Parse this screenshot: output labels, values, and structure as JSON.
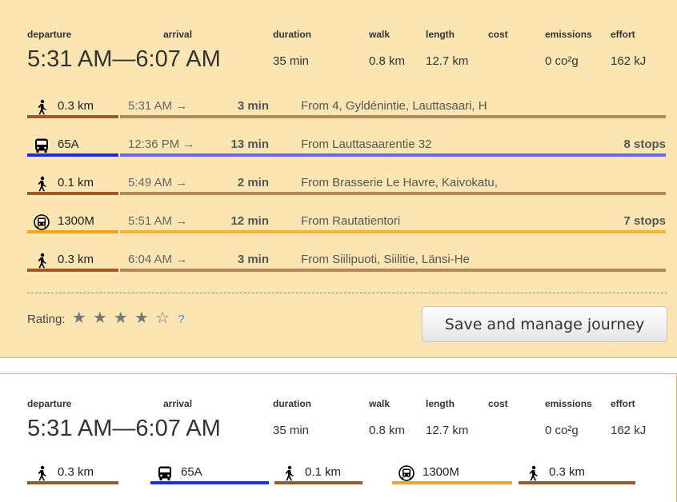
{
  "colors": {
    "card_bg": "#fbe6b3",
    "walk": "#9b5a24",
    "bus": "#1a2fd6",
    "metro": "#f3a51c",
    "rating_help": "#3a8fd8"
  },
  "journey1": {
    "labels": {
      "departure": "departure",
      "arrival": "arrival",
      "duration": "duration",
      "walk": "walk",
      "length": "length",
      "cost": "cost",
      "emissions": "emissions",
      "effort": "effort"
    },
    "departure_time": "5:31 AM",
    "dash": "—",
    "arrival_time": "6:07 AM",
    "duration": "35 min",
    "walk": "0.8 km",
    "length": "12.7 km",
    "emissions": "0 co²g",
    "effort": "162 kJ",
    "legs": [
      {
        "mode": "walk",
        "icon": "walk-icon",
        "label": "0.3 km",
        "start": "5:31 AM →",
        "duration": "3 min",
        "from": "From 4, Gyldénintie, Lauttasaari, H",
        "stops": ""
      },
      {
        "mode": "bus",
        "icon": "bus-icon",
        "label": "65A",
        "start": "12:36 PM →",
        "duration": "13 min",
        "from": "From Lauttasaarentie 32",
        "stops": "8 stops"
      },
      {
        "mode": "walk",
        "icon": "walk-icon",
        "label": "0.1 km",
        "start": "5:49 AM →",
        "duration": "2 min",
        "from": "From Brasserie Le Havre, Kaivokatu,",
        "stops": ""
      },
      {
        "mode": "metro",
        "icon": "metro-icon",
        "label": "1300M",
        "start": "5:51 AM →",
        "duration": "12 min",
        "from": "From Rautatientori",
        "stops": "7 stops"
      },
      {
        "mode": "walk",
        "icon": "walk-icon",
        "label": "0.3 km",
        "start": "6:04 AM →",
        "duration": "3 min",
        "from": "From Siilipuoti, Siilitie, Länsi-He",
        "stops": ""
      }
    ],
    "rating": {
      "label": "Rating:",
      "stars_filled": 4,
      "stars_total": 5,
      "filled_glyph": "★",
      "empty_glyph": "☆",
      "help": "?"
    },
    "save_button": "Save and manage journey"
  },
  "journey2": {
    "labels": {
      "departure": "departure",
      "arrival": "arrival",
      "duration": "duration",
      "walk": "walk",
      "length": "length",
      "cost": "cost",
      "emissions": "emissions",
      "effort": "effort"
    },
    "departure_time": "5:31 AM",
    "dash": "—",
    "arrival_time": "6:07 AM",
    "duration": "35 min",
    "walk": "0.8 km",
    "length": "12.7 km",
    "emissions": "0 co²g",
    "effort": "162 kJ",
    "legs": [
      {
        "mode": "walk",
        "icon": "walk-icon",
        "label": "0.3 km"
      },
      {
        "mode": "bus",
        "icon": "bus-icon",
        "label": "65A"
      },
      {
        "mode": "walk",
        "icon": "walk-icon",
        "label": "0.1 km"
      },
      {
        "mode": "metro",
        "icon": "metro-icon",
        "label": "1300M"
      },
      {
        "mode": "walk",
        "icon": "walk-icon",
        "label": "0.3 km"
      }
    ]
  }
}
